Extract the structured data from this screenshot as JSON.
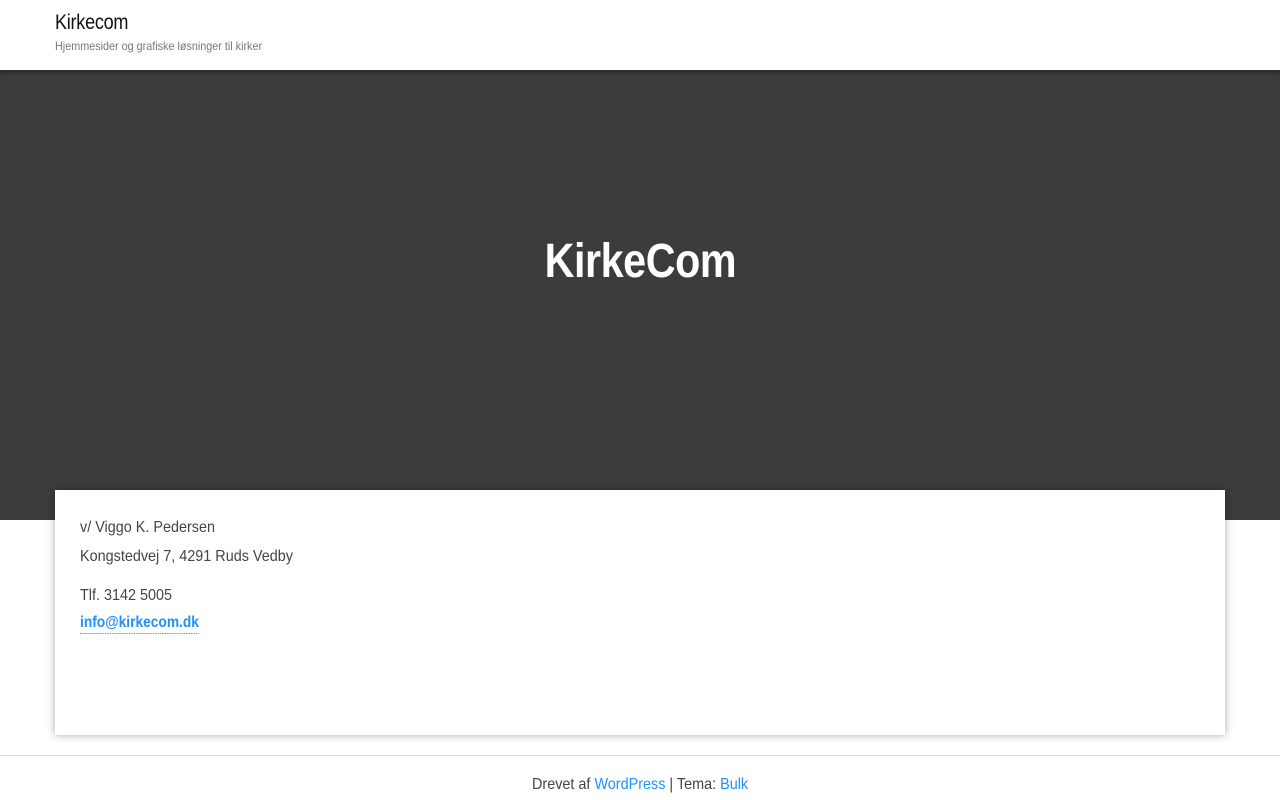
{
  "header": {
    "site_title": "Kirkecom",
    "tagline": "Hjemmesider og grafiske løsninger til kirker"
  },
  "hero": {
    "title": "KirkeCom"
  },
  "content": {
    "contact_person": "v/ Viggo K. Pedersen",
    "address": "Kongstedvej 7, 4291 Ruds Vedby",
    "phone": "Tlf. 3142 5005",
    "email": "info@kirkecom.dk"
  },
  "footer": {
    "powered_by_text": "Drevet af",
    "wordpress_link": "WordPress",
    "separator_text": "| Tema:",
    "theme_link": "Bulk"
  },
  "colors": {
    "hero_background": "#3c3c3c",
    "link": "#1e90ff",
    "text": "#444444"
  }
}
